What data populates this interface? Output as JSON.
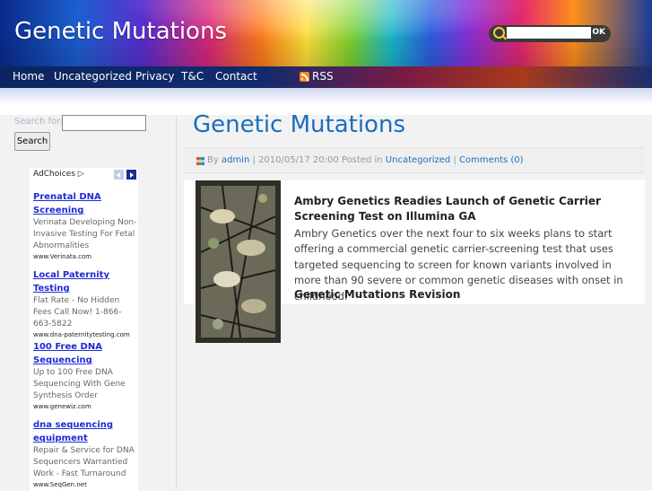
{
  "site": {
    "title": "Genetic Mutations"
  },
  "header_search": {
    "placeholder": "",
    "button_label": "OK"
  },
  "nav": {
    "items": [
      "Home",
      "Uncategorized",
      "Privacy",
      "T&C",
      "Contact"
    ],
    "rss_label": "RSS"
  },
  "sidebar": {
    "search_label": "Search for:",
    "search_value": "",
    "search_button": "Search",
    "ad": {
      "header": "AdChoices ▷",
      "units": [
        {
          "title": "Prenatal DNA Screening",
          "desc": "Verinata Developing Non-Invasive Testing For Fetal Abnormalities",
          "url": "www.Verinata.com"
        },
        {
          "title": "Local Paternity Testing",
          "desc": "Flat Rate - No Hidden Fees Call Now! 1-866-663-5822",
          "url": "www.dna-paternitytesting.com"
        },
        {
          "title": "100 Free DNA Sequencing",
          "desc": "Up to 100 Free DNA Sequencing With Gene Synthesis Order",
          "url": "www.genewiz.com"
        },
        {
          "title": "dna sequencing equipment",
          "desc": "Repair & Service for DNA Sequencers Warrantied Work - Fast Turnaround",
          "url": "www.SeqGen.net"
        }
      ]
    }
  },
  "post": {
    "title": "Genetic Mutations",
    "meta": {
      "by_label": "By",
      "author": "admin",
      "sep1": "|",
      "date": "2010/05/17 20:00",
      "posted_in": "Posted in",
      "category": "Uncategorized",
      "sep2": "|",
      "comments": "Comments (0)"
    },
    "headline": "Ambry Genetics Readies Launch of Genetic Carrier Screening Test on Illumina GA",
    "summary": "Ambry Genetics over the next four to six weeks plans to start offering a commercial genetic carrier-screening test that uses targeted sequencing to screen for known variants involved in more than 90 severe or common genetic diseases with onset in childhood.",
    "revision": "Genetic Mutations Revision"
  },
  "colors": {
    "link": "#1a6ec0",
    "ad_link": "#1f2bd6",
    "rss": "#f08a24",
    "nav_bg": "#0d1f4a"
  }
}
